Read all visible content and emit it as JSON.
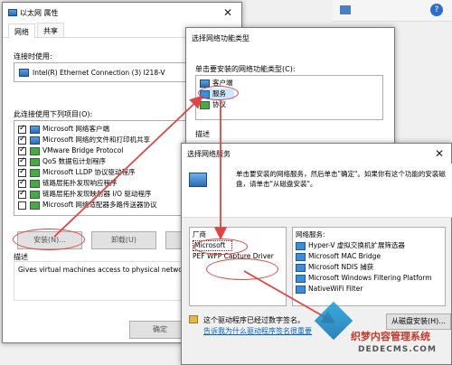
{
  "bg_window": {
    "title": "以太网 属性",
    "tabs": [
      "网络",
      "共享"
    ],
    "connect_using_label": "连接时使用:",
    "adapter_name": "Intel(R) Ethernet Connection (3) I218-V",
    "items_label": "此连接使用下列项目(O):",
    "items": [
      {
        "checked": true,
        "label": "Microsoft 网络客户端",
        "icon": "network-client-icon"
      },
      {
        "checked": true,
        "label": "Microsoft 网络的文件和打印机共享",
        "icon": "network-share-icon"
      },
      {
        "checked": true,
        "label": "VMware Bridge Protocol",
        "icon": "network-protocol-icon"
      },
      {
        "checked": true,
        "label": "QoS 数据包计划程序",
        "icon": "network-protocol-icon"
      },
      {
        "checked": true,
        "label": "Microsoft LLDP 协议驱动程序",
        "icon": "network-protocol-icon"
      },
      {
        "checked": true,
        "label": "链路层拓扑发现响应程序",
        "icon": "network-protocol-icon"
      },
      {
        "checked": true,
        "label": "链路层拓扑发现映射器 I/O 驱动程序",
        "icon": "network-protocol-icon"
      },
      {
        "checked": false,
        "label": "Microsoft 网络适配器多路传送器协议",
        "icon": "network-protocol-icon"
      }
    ],
    "install_btn": "安装(N)...",
    "uninstall_btn": "卸载(U)",
    "description_label": "描述",
    "description_text": "Gives virtual machines access to physical netwo",
    "ok_btn": "确定"
  },
  "select_type_window": {
    "title": "选择网络功能类型",
    "prompt": "单击要安装的网络功能类型(C):",
    "types": [
      {
        "label": "客户端",
        "icon": "client-icon"
      },
      {
        "label": "服务",
        "icon": "service-icon"
      },
      {
        "label": "协议",
        "icon": "protocol-icon"
      }
    ],
    "description_label": "描述"
  },
  "select_service_window": {
    "title": "选择网络服务",
    "instruction": "单击要安装的网络服务，然后单击\"确定\"。如果你有这个功能的安装磁盘，请单击\"从磁盘安装\"。",
    "vendor_label": "厂商",
    "vendors": [
      "Microsoft",
      "PEF WFP Capture Driver"
    ],
    "services_label": "网络服务:",
    "services": [
      "Hyper-V 虚拟交换机扩展筛选器",
      "Microsoft MAC Bridge",
      "Microsoft NDIS 捕获",
      "Microsoft Windows Filtering Platform",
      "NativeWiFi Filter"
    ],
    "signed_text": "这个驱动程序已经过数字签名。",
    "why_link": "告诉我为什么驱动程序签名很重要",
    "from_disk_btn": "从磁盘安装(H)..."
  },
  "watermark": {
    "brand": "织梦内容管理系统",
    "url": "DEDECMS.COM"
  },
  "colors": {
    "annotation_red": "#e04545",
    "link_blue": "#0066cc",
    "selection_blue": "#cce8ff"
  }
}
